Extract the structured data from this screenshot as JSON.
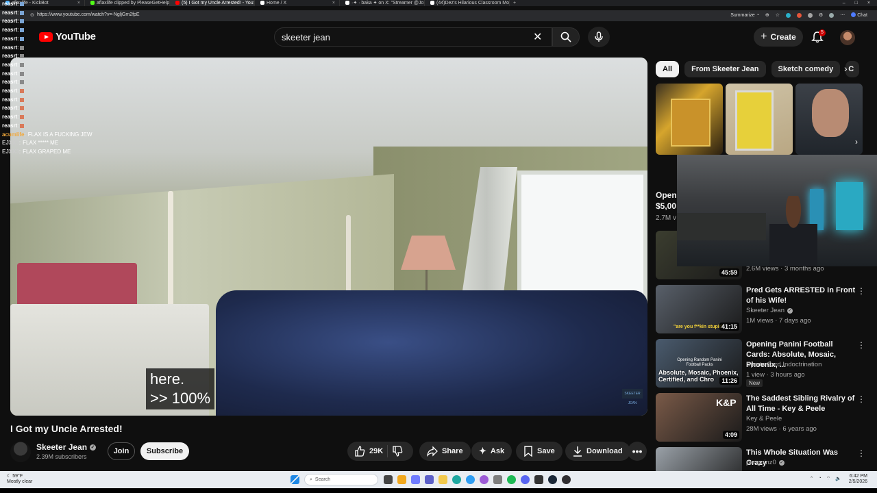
{
  "browser": {
    "tabs": [
      {
        "label": "aflaxlife - KickBot",
        "color": "#53b4ff",
        "active": false
      },
      {
        "label": "aflaxlife clipped by PleaseGetHelp",
        "color": "#53fc18",
        "active": false
      },
      {
        "label": "(5) I Got my Uncle Arrested! - You",
        "color": "#ff0000",
        "active": true
      },
      {
        "label": "Home / X",
        "color": "#ffffff",
        "active": false
      },
      {
        "label": "·✦ · baka ✦ on X: \"Streamer @Jo",
        "color": "#ffffff",
        "active": false
      },
      {
        "label": "(44)Dez's Hilarious Classroom Mo",
        "color": "#ffffff",
        "active": false
      }
    ],
    "tab_close": "×",
    "new_tab": "+",
    "window_buttons": [
      "–",
      "□",
      "×"
    ],
    "url": "https://www.youtube.com/watch?v=-NgljGm2fpE",
    "summarize_label": "Summarize",
    "chat_label": "Chat"
  },
  "chat_overlay": {
    "lines": [
      {
        "user": "reasrt",
        "text": "",
        "color": "#ffffff",
        "badge_color": "#7aa4d4"
      },
      {
        "user": "reasrt",
        "text": "",
        "color": "#ffffff",
        "badge_color": "#7aa4d4"
      },
      {
        "user": "reasrt",
        "text": "",
        "color": "#ffffff",
        "badge_color": "#7aa4d4"
      },
      {
        "user": "reasrt",
        "text": "",
        "color": "#ffffff",
        "badge_color": "#7aa4d4"
      },
      {
        "user": "reasrt",
        "text": "",
        "color": "#ffffff",
        "badge_color": "#7aa4d4"
      },
      {
        "user": "reasrt",
        "text": "",
        "color": "#ffffff",
        "badge_color": "#8a8a8a"
      },
      {
        "user": "reasrt",
        "text": "",
        "color": "#ffffff",
        "badge_color": "#8a8a8a"
      },
      {
        "user": "reasrt",
        "text": "",
        "color": "#ffffff",
        "badge_color": "#8a8a8a"
      },
      {
        "user": "reasrt",
        "text": "",
        "color": "#ffffff",
        "badge_color": "#8a8a8a"
      },
      {
        "user": "reasrt",
        "text": "",
        "color": "#ffffff",
        "badge_color": "#8a8a8a"
      },
      {
        "user": "reasrt",
        "text": "",
        "color": "#ffffff",
        "badge_color": "#d97a5a"
      },
      {
        "user": "reasrt",
        "text": "",
        "color": "#ffffff",
        "badge_color": "#d97a5a"
      },
      {
        "user": "reasrt",
        "text": "",
        "color": "#ffffff",
        "badge_color": "#d97a5a"
      },
      {
        "user": "reasrt",
        "text": "",
        "color": "#ffffff",
        "badge_color": "#d97a5a"
      },
      {
        "user": "reasrt",
        "text": "",
        "color": "#ffffff",
        "badge_color": "#d97a5a"
      },
      {
        "user": "acumlife",
        "text": "FLAX IS A FUCKING JEW",
        "color": "#f2a93b",
        "badge_color": ""
      },
      {
        "user": "EJXX3",
        "text": "FLAX ***** ME",
        "color": "#cccccc",
        "badge_color": ""
      },
      {
        "user": "EJXX3",
        "text": "FLAX GRAPED ME",
        "color": "#cccccc",
        "badge_color": ""
      }
    ]
  },
  "header": {
    "logo_text": "YouTube",
    "search_value": "skeeter jean",
    "clear_icon": "✕",
    "create_label": "Create",
    "notification_count": "5"
  },
  "video": {
    "caption_line1": "here.",
    "caption_line2": ">> 100%",
    "watermark": "SKEETER JEAN",
    "title": "I Got my Uncle Arrested!",
    "channel_name": "Skeeter Jean",
    "subscribers": "2.39M subscribers",
    "join_label": "Join",
    "subscribe_label": "Subscribe",
    "like_count": "29K",
    "share_label": "Share",
    "ask_label": "Ask",
    "save_label": "Save",
    "download_label": "Download"
  },
  "sidebar": {
    "chips": [
      "All",
      "From Skeeter Jean",
      "Sketch comedy",
      "C"
    ],
    "shelf": {
      "title_line1": "Openi",
      "title_line2": "$5,00",
      "views": "2.7M v"
    },
    "recommendations": [
      {
        "title": "",
        "channel": "",
        "meta": "2.6M views · 3 months ago",
        "duration": "45:59",
        "verified": false,
        "new": false,
        "thumb": "#3b3d2f"
      },
      {
        "title": "Pred Gets ARRESTED in Front of his Wife!",
        "channel": "Skeeter Jean",
        "meta": "1M views · 7 days ago",
        "duration": "41:15",
        "verified": true,
        "new": false,
        "thumb": "#59606a"
      },
      {
        "title": "Opening Panini Football Cards: Absolute, Mosaic, Phoenix, ...",
        "channel": "Sports Card Indoctrination",
        "meta": "1 view · 3 hours ago",
        "duration": "11:26",
        "verified": false,
        "new": true,
        "thumb": "#4a5b6e"
      },
      {
        "title": "The Saddest Sibling Rivalry of All Time - Key & Peele",
        "channel": "Key & Peele",
        "meta": "28M views · 6 years ago",
        "duration": "4:09",
        "verified": false,
        "new": false,
        "thumb": "#7a5a48"
      },
      {
        "title": "This Whole Situation Was Crazy",
        "channel": "penguinz0",
        "meta": "",
        "duration": "",
        "verified": true,
        "new": false,
        "thumb": "#9aa1a8"
      }
    ],
    "new_label": "New",
    "more_icon": "⋮"
  },
  "thumb_texts": {
    "panini_overlay": "Opening Random Panini Football Packs",
    "panini_big": "Absolute, Mosaic, Phoenix, Certified, and Chro",
    "pred_caption": "\"are you f**kin stupid\"",
    "kp": "K&P"
  },
  "taskbar": {
    "weather_temp": "59°F",
    "weather_desc": "Mostly clear",
    "search_placeholder": "Search",
    "time": "6:42 PM",
    "date": "2/5/2026"
  }
}
